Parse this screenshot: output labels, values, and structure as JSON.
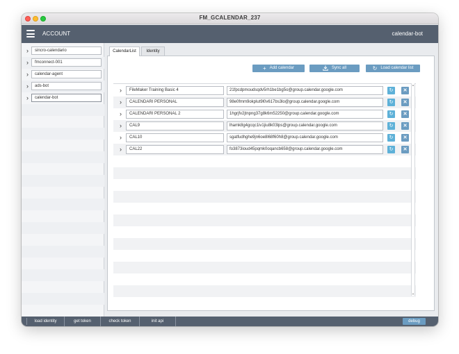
{
  "window": {
    "title": "FM_GCALENDAR_237"
  },
  "header": {
    "account_label": "ACCOUNT",
    "user": "calendar-bot"
  },
  "sidebar": {
    "items": [
      {
        "label": "sincro-calendario"
      },
      {
        "label": "fmconnect-001"
      },
      {
        "label": "calendar-agent"
      },
      {
        "label": "ads-bot"
      },
      {
        "label": "calendar-bot",
        "selected": true
      }
    ]
  },
  "tabs": [
    {
      "label": "CalendarList",
      "active": true
    },
    {
      "label": "Identity",
      "active": false
    }
  ],
  "toolbar": {
    "add_label": "Add calendar",
    "sync_label": "Sync all",
    "load_label": "Load calendar list"
  },
  "calendars": [
    {
      "name": "FileMaker Training Basic 4",
      "id": "21fpcdpmoudsqdv5rh1be1bg5o@group.calendar.google.com"
    },
    {
      "name": "CALENDARI PERSONAL",
      "id": "98e0fmm9okplut9l0v617bs3lo@group.calendar.google.com"
    },
    {
      "name": "CALENDARI PERSONAL 2",
      "id": "1hgrjfv2jtnpng37g8k6m52250@group.calendar.google.com"
    },
    {
      "name": "CAL9",
      "id": "lhamk8g4gcqc1iv1jiu8k03lps@group.calendar.google.com"
    },
    {
      "name": "CAL10",
      "id": "sgatfudhghe9jn6oe8l68f60h8@group.calendar.google.com"
    },
    {
      "name": "CAL22",
      "id": "fo3873ioud45pqmk0oqancb658@group.calendar.google.com"
    }
  ],
  "footer": {
    "load_identity": "load identity",
    "get_token": "get token",
    "check_token": "check token",
    "init_api": "init api",
    "debug": "debug"
  },
  "colors": {
    "header_bg": "#55606f",
    "button_blue": "#6b9cc1",
    "sync_icon_bg": "#5eb1d8"
  }
}
